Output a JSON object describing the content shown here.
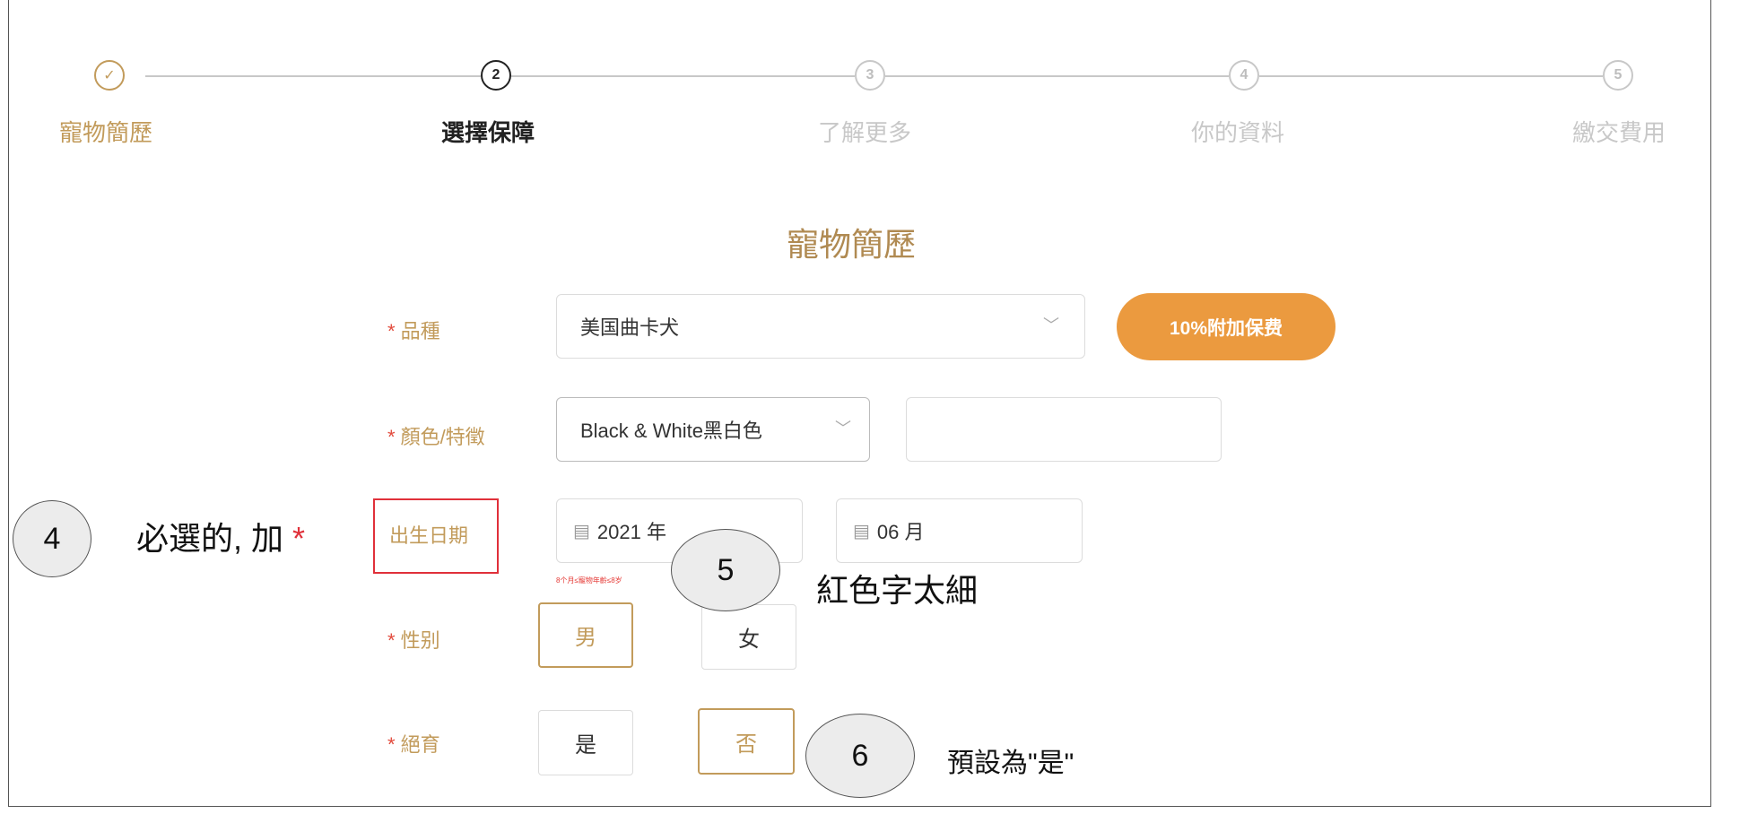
{
  "stepper": {
    "steps": [
      {
        "num": "✓",
        "label": "寵物簡歷",
        "state": "done"
      },
      {
        "num": "2",
        "label": "選擇保障",
        "state": "active"
      },
      {
        "num": "3",
        "label": "了解更多",
        "state": "todo"
      },
      {
        "num": "4",
        "label": "你的資料",
        "state": "todo"
      },
      {
        "num": "5",
        "label": "繳交費用",
        "state": "todo"
      }
    ]
  },
  "section_title": "寵物簡歷",
  "form": {
    "breed": {
      "label": "品種",
      "value": "美国曲卡犬",
      "badge": "10%附加保费"
    },
    "color": {
      "label": "顏色/特徵",
      "value": "Black & White黑白色",
      "extra": ""
    },
    "dob": {
      "label": "出生日期",
      "year": "2021 年",
      "month": "06 月",
      "hint": "8个月≤寵物年齡≤8岁"
    },
    "gender": {
      "label": "性别",
      "options": [
        "男",
        "女"
      ],
      "selected": "男"
    },
    "neutered": {
      "label": "絕育",
      "options": [
        "是",
        "否"
      ],
      "selected": "否"
    },
    "required_mark": "*"
  },
  "annotations": {
    "a4": {
      "num": "4",
      "text": "必選的, 加",
      "star": "*"
    },
    "a5": {
      "num": "5",
      "text": "紅色字太細"
    },
    "a6": {
      "num": "6",
      "text": "預設為\"是\""
    }
  },
  "colors": {
    "accent": "#c29b5b",
    "badge": "#eb9a3f",
    "required": "#e24b3d",
    "annotation": "#e0303a"
  }
}
